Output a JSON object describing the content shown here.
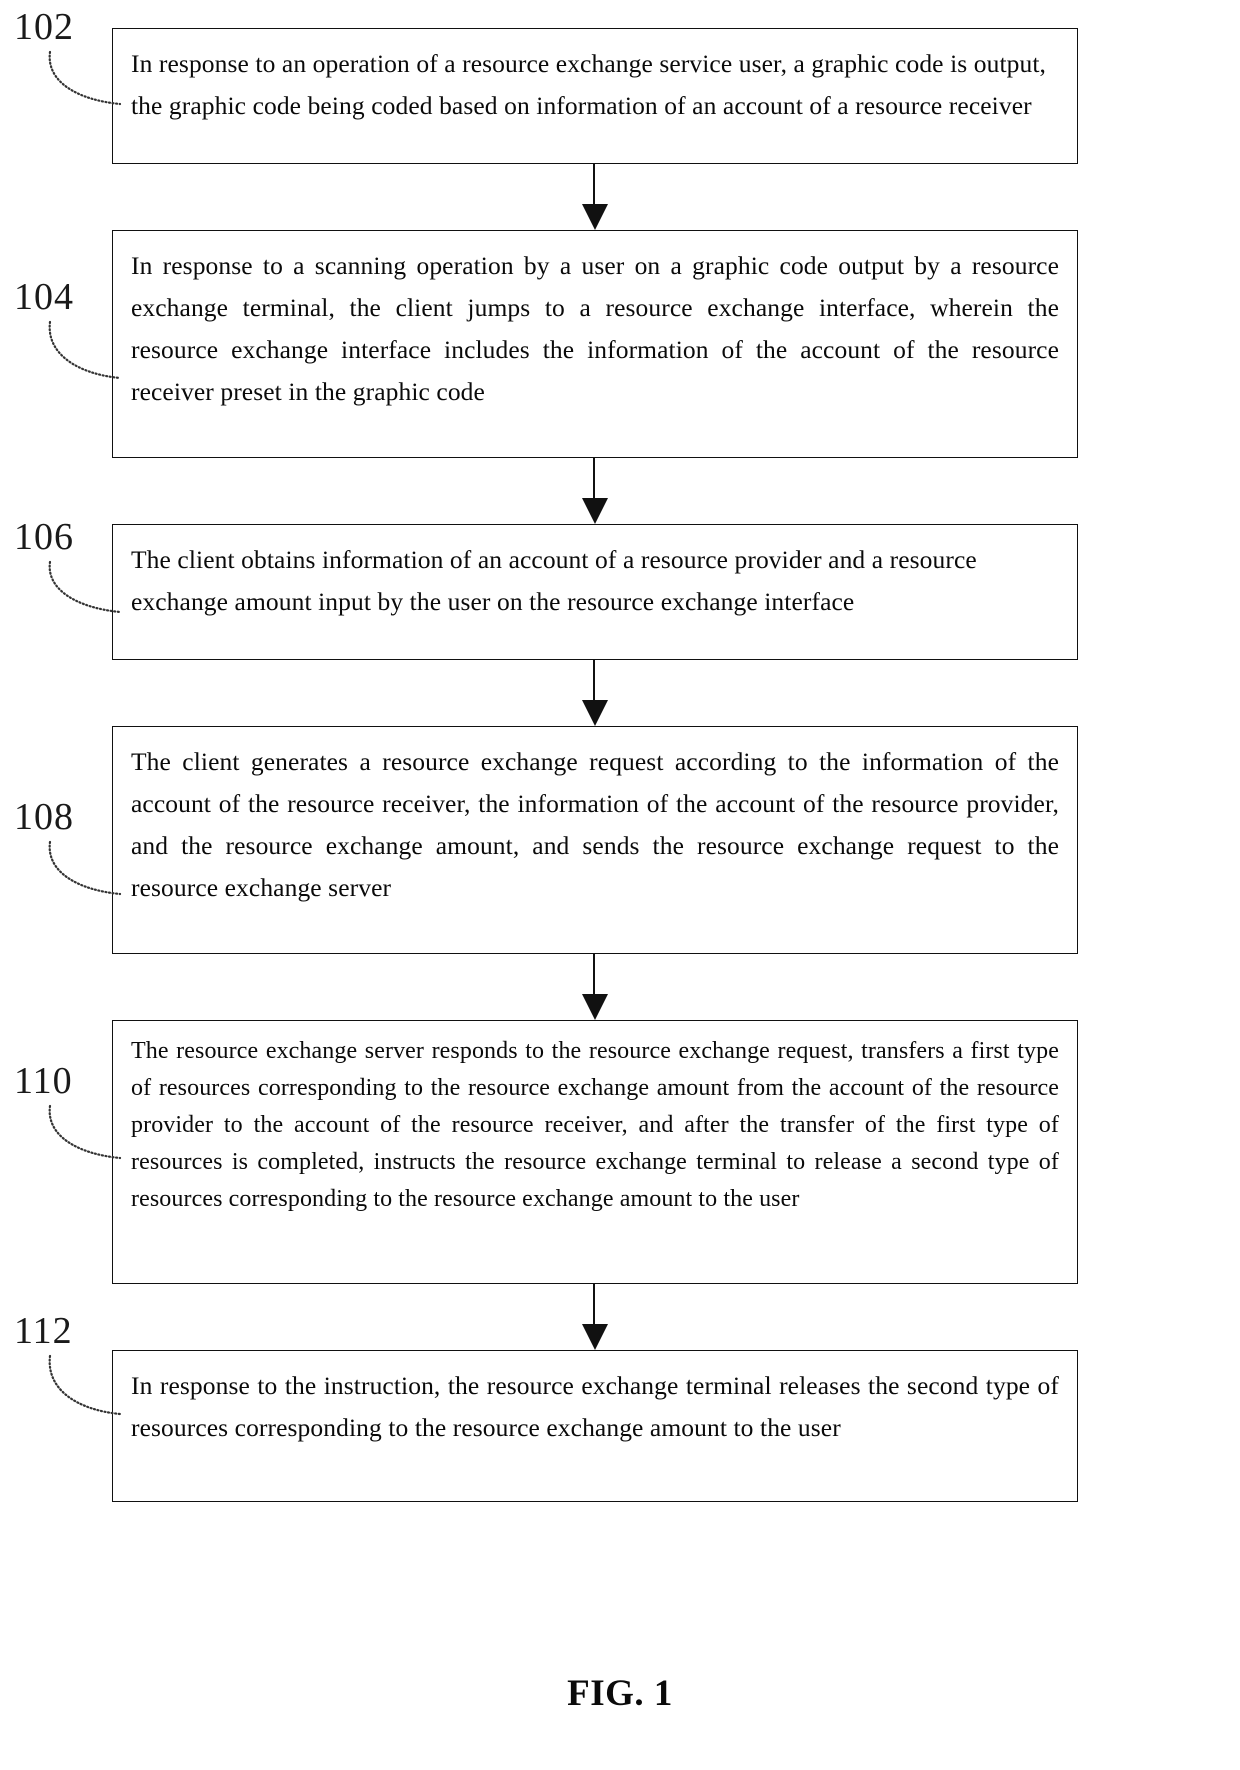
{
  "figure": {
    "caption": "FIG. 1",
    "type": "patent-flowchart",
    "orientation": "vertical",
    "step_count": 6
  },
  "steps": [
    {
      "ref": "102",
      "align": "ragged",
      "text": "In response to an operation of a resource exchange service user, a graphic code is output, the graphic code being coded based on information of an account of a resource receiver"
    },
    {
      "ref": "104",
      "align": "justify",
      "text": "In response to a scanning operation by a user on a graphic code output by a resource exchange terminal, the client jumps to a resource exchange interface, wherein the resource exchange interface includes the information of the account of the resource receiver preset in the graphic code"
    },
    {
      "ref": "106",
      "align": "ragged",
      "text": "The client obtains information of an account of a resource provider and a resource exchange amount input by the user on the resource exchange interface"
    },
    {
      "ref": "108",
      "align": "justify",
      "text": "The client generates a resource exchange request according to the information of the account of the resource receiver, the information of the account of the resource provider, and the resource exchange amount, and sends the resource exchange request to the resource exchange server"
    },
    {
      "ref": "110",
      "align": "justify",
      "text": "The resource exchange server responds to the resource exchange request, transfers a first type of resources corresponding to the resource exchange amount from the account of the resource provider to the account of the resource receiver, and after the transfer of the first type of resources is completed, instructs the resource exchange terminal to release a second type of resources corresponding to the resource exchange amount to the user"
    },
    {
      "ref": "112",
      "align": "justify",
      "text": "In response to the instruction, the resource exchange terminal releases the second type of resources corresponding to the resource exchange amount to the user"
    }
  ],
  "connectors": [
    {
      "from": "102",
      "to": "104",
      "arrow": "down-arrow-icon"
    },
    {
      "from": "104",
      "to": "106",
      "arrow": "down-arrow-icon"
    },
    {
      "from": "106",
      "to": "108",
      "arrow": "down-arrow-icon"
    },
    {
      "from": "108",
      "to": "110",
      "arrow": "down-arrow-icon"
    },
    {
      "from": "110",
      "to": "112",
      "arrow": "down-arrow-icon"
    }
  ],
  "colors": {
    "ink": "#111111",
    "paper": "#ffffff",
    "leader": "#333333"
  }
}
